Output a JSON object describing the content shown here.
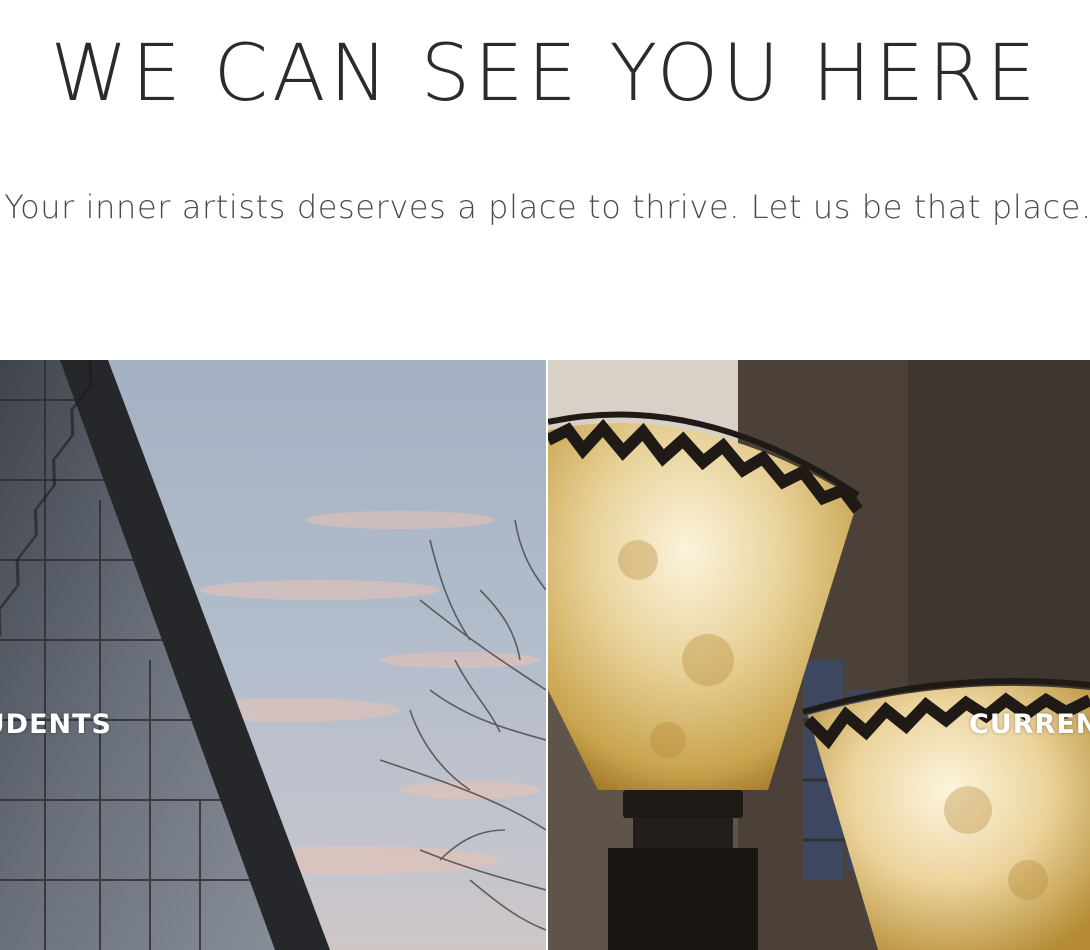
{
  "hero": {
    "title": "WE CAN SEE YOU HERE",
    "subtitle": "Your inner artists deserves a place to thrive. Let us be that place."
  },
  "panels": [
    {
      "label": "PROSPECTIVE STUDENTS",
      "image": "building-at-dusk"
    },
    {
      "label": "CURRENT STUDENTS",
      "image": "lamp-shades"
    }
  ],
  "colors": {
    "title_text": "#2b2b2b",
    "body_text": "#4a4a4a",
    "label_text": "#ffffff"
  }
}
